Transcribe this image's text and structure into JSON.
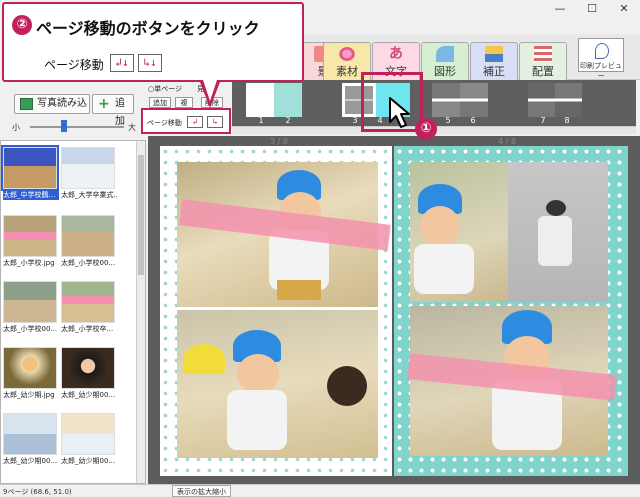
{
  "callout_top": {
    "number": "②",
    "title": "ページ移動のボタンをクリック",
    "label": "ページ移動",
    "btn_left_glyph": "↲↓",
    "btn_right_glyph": "↳↓"
  },
  "callout_step1": {
    "number": "①"
  },
  "window_controls": {
    "minimize": "—",
    "maximize": "☐",
    "close": "✕"
  },
  "ribbon_tabs": [
    {
      "label": "景",
      "icon": "frame-icon"
    },
    {
      "label": "素材",
      "icon": "flower-icon"
    },
    {
      "label": "文字",
      "icon": "text-icon"
    },
    {
      "label": "図形",
      "icon": "shape-icon"
    },
    {
      "label": "補正",
      "icon": "adjust-icon"
    },
    {
      "label": "配置",
      "icon": "layout-icon"
    }
  ],
  "print_preview": {
    "label": "印刷プレビュー",
    "icon": "magnifier-icon"
  },
  "left_toolbar": {
    "load_photo": "写真読み込",
    "add": "追加",
    "zoom_min": "小",
    "zoom_max": "大",
    "zoom_level": 0.35
  },
  "page_controls": {
    "single_page": "○単ページ",
    "spread": "見開",
    "add_btn": "追加",
    "copy_btn": "複",
    "delete_btn": "削除",
    "page_move": "ページ移動",
    "btn_left_glyph": "↲",
    "btn_right_glyph": "↳"
  },
  "page_strip": {
    "pages": [
      {
        "label": "1",
        "label2": "2"
      },
      {
        "label": "3",
        "label2": "4"
      },
      {
        "label": "5",
        "label2": "6"
      },
      {
        "label": "7",
        "label2": "8"
      }
    ],
    "selected_page": "4"
  },
  "canvas": {
    "left_page_label": "3 / 8",
    "right_page_label": "4 / 8"
  },
  "photos": [
    {
      "caption": "太郎_中学校鶴..."
    },
    {
      "caption": "太郎_大学卒業式..."
    },
    {
      "caption": "太郎_小学校.jpg"
    },
    {
      "caption": "太郎_小学校00..."
    },
    {
      "caption": "太郎_小学校00..."
    },
    {
      "caption": "太郎_小学校卒..."
    },
    {
      "caption": "太郎_幼少期.jpg"
    },
    {
      "caption": "太郎_幼少期00..."
    },
    {
      "caption": "太郎_幼少期00..."
    },
    {
      "caption": "太郎_幼少期00..."
    }
  ],
  "status": {
    "left": "9ページ (68.6, 51.0)",
    "zoom": "表示の拡大縮小"
  },
  "colors": {
    "accent": "#c0215d",
    "mint": "#7fd4cb",
    "pink_band": "#f392ad"
  }
}
